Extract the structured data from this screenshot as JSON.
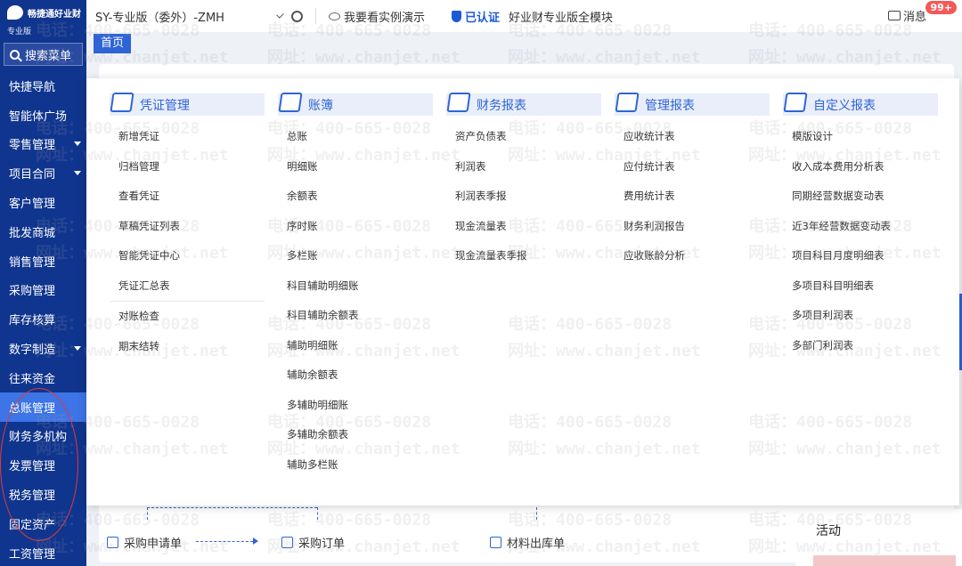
{
  "brand": {
    "name": "畅捷通好业财",
    "edition": "专业版"
  },
  "sidebar": {
    "search_label": "搜索菜单",
    "items": [
      {
        "label": "快捷导航",
        "caret": false
      },
      {
        "label": "智能体广场",
        "caret": false
      },
      {
        "label": "零售管理",
        "caret": true
      },
      {
        "label": "项目合同",
        "caret": true
      },
      {
        "label": "客户管理",
        "caret": false
      },
      {
        "label": "批发商城",
        "caret": false
      },
      {
        "label": "销售管理",
        "caret": false
      },
      {
        "label": "采购管理",
        "caret": false
      },
      {
        "label": "库存核算",
        "caret": false
      },
      {
        "label": "数字制造",
        "caret": true
      },
      {
        "label": "往来资金",
        "caret": false
      },
      {
        "label": "总账管理",
        "caret": false,
        "active": true
      },
      {
        "label": "财务多机构",
        "caret": false
      },
      {
        "label": "发票管理",
        "caret": false
      },
      {
        "label": "税务管理",
        "caret": false
      },
      {
        "label": "固定资产",
        "caret": false
      },
      {
        "label": "工资管理",
        "caret": false
      }
    ]
  },
  "topbar": {
    "account": "SY-专业版（委外）-ZMH",
    "demo_label": "我要看实例演示",
    "cert_label": "已认证",
    "edition_label": "好业财专业版全模块",
    "message_label": "消息",
    "message_badge": "99+"
  },
  "tabs": {
    "home": "首页"
  },
  "mega_menu": {
    "columns": [
      {
        "title": "凭证管理",
        "icon": "voucher-icon",
        "groups": [
          [
            "新增凭证",
            "归档管理",
            "查看凭证",
            "草稿凭证列表",
            "智能凭证中心",
            "凭证汇总表"
          ],
          [
            "对账检查",
            "期末结转"
          ]
        ]
      },
      {
        "title": "账簿",
        "icon": "ledger-icon",
        "groups": [
          [
            "总账",
            "明细账",
            "余额表",
            "序时账",
            "多栏账",
            "科目辅助明细账",
            "科目辅助余额表",
            "辅助明细账",
            "辅助余额表",
            "多辅助明细账",
            "多辅助余额表",
            "辅助多栏账"
          ]
        ]
      },
      {
        "title": "财务报表",
        "icon": "financial-report-icon",
        "groups": [
          [
            "资产负债表",
            "利润表",
            "利润表季报",
            "现金流量表",
            "现金流量表季报"
          ]
        ]
      },
      {
        "title": "管理报表",
        "icon": "management-report-icon",
        "groups": [
          [
            "应收统计表",
            "应付统计表",
            "费用统计表",
            "财务利润报告",
            "应收账龄分析"
          ]
        ]
      },
      {
        "title": "自定义报表",
        "icon": "custom-report-icon",
        "groups": [
          [
            "模版设计",
            "收入成本费用分析表",
            "同期经营数据变动表",
            "近3年经营数据变动表",
            "项目科目月度明细表",
            "多项目科目明细表",
            "多项目利润表",
            "多部门利润表"
          ]
        ]
      }
    ]
  },
  "flow": {
    "purchase_request": "采购申请单",
    "purchase_order": "采购订单",
    "material_issue": "材料出库单"
  },
  "activity": {
    "title": "活动"
  },
  "watermark": {
    "phone": "电话：400-665-0028",
    "site": "网址：www.chanjet.net"
  },
  "colors": {
    "sidebar": "#10358e",
    "accent": "#2f64d6",
    "active": "#3d74e6"
  }
}
